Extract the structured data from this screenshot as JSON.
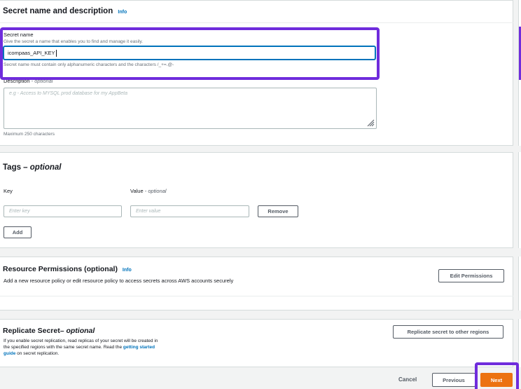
{
  "secret_section": {
    "title": "Secret name and description",
    "info": "Info",
    "name_label": "Secret name",
    "name_hint": "Give the secret a name that enables you to find and manage it easily.",
    "name_value": "icompaas_API_KEY",
    "name_constraint": "Secret name must contain only alphanumeric characters and the characters /_+=.@-",
    "description_label": "Description",
    "description_optional": "- optional",
    "description_placeholder": "e.g - Access to MYSQL prod database for my AppBeta",
    "description_limit": "Maximum 250 characters"
  },
  "tags_section": {
    "title_prefix": "Tags –",
    "title_optional": "optional",
    "key_label": "Key",
    "value_label": "Value",
    "value_optional": "- optional",
    "key_placeholder": "Enter key",
    "value_placeholder": "Enter value",
    "remove_label": "Remove",
    "add_label": "Add"
  },
  "permissions_section": {
    "title": "Resource Permissions (optional)",
    "info": "Info",
    "description": "Add a new resource policy or edit resource policy to access secrets across AWS accounts securely",
    "edit_label": "Edit Permissions"
  },
  "replicate_section": {
    "title_prefix": "Replicate Secret–",
    "title_optional": "optional",
    "text_1": "If you enable secret replication, read replicas of your secret will be created in",
    "text_2": "the specified regions with the same secret name. Read the",
    "link_1": "getting started",
    "link_2": "guide",
    "text_3": "on secret replication.",
    "replicate_label": "Replicate secret to other regions"
  },
  "footer": {
    "cancel_label": "Cancel",
    "previous_label": "Previous",
    "next_label": "Next"
  },
  "colors": {
    "accent": "#ec7211",
    "highlight": "#6f2cdc",
    "link": "#0073bb"
  }
}
